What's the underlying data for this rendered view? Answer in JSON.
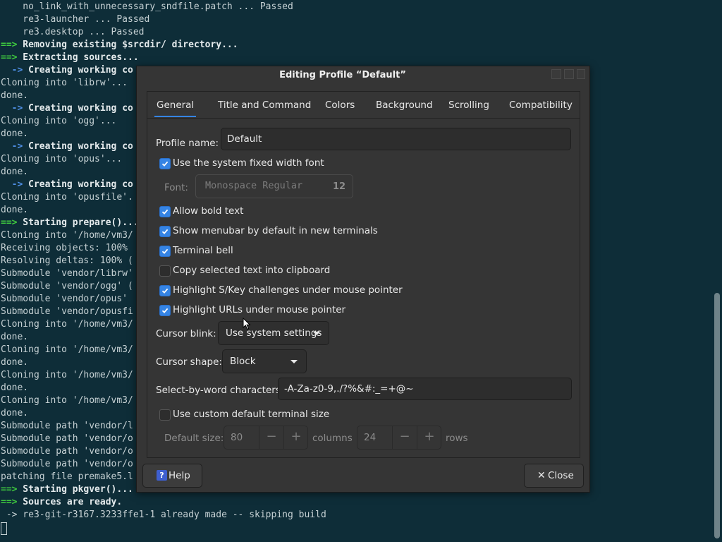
{
  "terminal": {
    "lines": [
      {
        "prefix": "",
        "text": "    no_link_with_unnecessary_sndfile.patch ... Passed",
        "style": "plain"
      },
      {
        "prefix": "",
        "text": "    re3-launcher ... Passed",
        "style": "plain"
      },
      {
        "prefix": "",
        "text": "    re3.desktop ... Passed",
        "style": "plain"
      },
      {
        "prefix": "==>",
        "text": " Removing existing $srcdir/ directory...",
        "style": "green"
      },
      {
        "prefix": "==>",
        "text": " Extracting sources...",
        "style": "green"
      },
      {
        "prefix": "  ->",
        "text": " Creating working co",
        "style": "blue"
      },
      {
        "prefix": "",
        "text": "Cloning into 'librw'...",
        "style": "plain"
      },
      {
        "prefix": "",
        "text": "done.",
        "style": "plain"
      },
      {
        "prefix": "  ->",
        "text": " Creating working co",
        "style": "blue"
      },
      {
        "prefix": "",
        "text": "Cloning into 'ogg'...",
        "style": "plain"
      },
      {
        "prefix": "",
        "text": "done.",
        "style": "plain"
      },
      {
        "prefix": "  ->",
        "text": " Creating working co",
        "style": "blue"
      },
      {
        "prefix": "",
        "text": "Cloning into 'opus'...",
        "style": "plain"
      },
      {
        "prefix": "",
        "text": "done.",
        "style": "plain"
      },
      {
        "prefix": "  ->",
        "text": " Creating working co",
        "style": "blue"
      },
      {
        "prefix": "",
        "text": "Cloning into 'opusfile'.",
        "style": "plain"
      },
      {
        "prefix": "",
        "text": "done.",
        "style": "plain"
      },
      {
        "prefix": "==>",
        "text": " Starting prepare()...",
        "style": "green"
      },
      {
        "prefix": "",
        "text": "Cloning into '/home/vm3/",
        "style": "plain"
      },
      {
        "prefix": "",
        "text": "Receiving objects: 100%",
        "style": "plain"
      },
      {
        "prefix": "",
        "text": "Resolving deltas: 100% (",
        "style": "plain"
      },
      {
        "prefix": "",
        "text": "Submodule 'vendor/librw'",
        "style": "plain"
      },
      {
        "prefix": "",
        "text": "Submodule 'vendor/ogg' (",
        "style": "plain"
      },
      {
        "prefix": "",
        "text": "Submodule 'vendor/opus'",
        "style": "plain"
      },
      {
        "prefix": "",
        "text": "Submodule 'vendor/opusfi",
        "style": "plain"
      },
      {
        "prefix": "",
        "text": "Cloning into '/home/vm3/",
        "style": "plain"
      },
      {
        "prefix": "",
        "text": "done.",
        "style": "plain"
      },
      {
        "prefix": "",
        "text": "Cloning into '/home/vm3/",
        "style": "plain"
      },
      {
        "prefix": "",
        "text": "done.",
        "style": "plain"
      },
      {
        "prefix": "",
        "text": "Cloning into '/home/vm3/",
        "style": "plain"
      },
      {
        "prefix": "",
        "text": "done.",
        "style": "plain"
      },
      {
        "prefix": "",
        "text": "Cloning into '/home/vm3/",
        "style": "plain"
      },
      {
        "prefix": "",
        "text": "done.",
        "style": "plain"
      },
      {
        "prefix": "",
        "text": "Submodule path 'vendor/l",
        "style": "plain"
      },
      {
        "prefix": "",
        "text": "Submodule path 'vendor/o",
        "style": "plain"
      },
      {
        "prefix": "",
        "text": "Submodule path 'vendor/o",
        "style": "plain"
      },
      {
        "prefix": "",
        "text": "Submodule path 'vendor/o",
        "style": "plain"
      },
      {
        "prefix": "",
        "text": "patching file premake5.l",
        "style": "plain"
      },
      {
        "prefix": "==>",
        "text": " Starting pkgver()...",
        "style": "green"
      },
      {
        "prefix": "==>",
        "text": " Sources are ready.",
        "style": "green"
      },
      {
        "prefix": " ->",
        "text": " re3-git-r3167.3233ffe1-1 already made -- skipping build",
        "style": "plainarrow"
      }
    ]
  },
  "dialog": {
    "title": "Editing Profile “Default”",
    "tabs": [
      {
        "label": "General",
        "active": true
      },
      {
        "label": "Title and Command",
        "active": false
      },
      {
        "label": "Colors",
        "active": false
      },
      {
        "label": "Background",
        "active": false
      },
      {
        "label": "Scrolling",
        "active": false
      },
      {
        "label": "Compatibility",
        "active": false
      }
    ],
    "profile_name_label": "Profile name:",
    "profile_name_value": "Default",
    "font_label": "Font:",
    "font_name": "Monospace Regular",
    "font_size": "12",
    "checkboxes": [
      {
        "label": "Use the system fixed width font",
        "checked": true
      },
      {
        "label": "Allow bold text",
        "checked": true
      },
      {
        "label": "Show menubar by default in new terminals",
        "checked": true
      },
      {
        "label": "Terminal bell",
        "checked": true
      },
      {
        "label": "Copy selected text into clipboard",
        "checked": false
      },
      {
        "label": "Highlight S/Key challenges under mouse pointer",
        "checked": true
      },
      {
        "label": "Highlight URLs under mouse pointer",
        "checked": true
      }
    ],
    "cursor_blink_label": "Cursor blink:",
    "cursor_blink_value": "Use system settings",
    "cursor_shape_label": "Cursor shape:",
    "cursor_shape_value": "Block",
    "word_chars_label": "Select-by-word characters:",
    "word_chars_value": "-A-Za-z0-9,./?%&#:_=+@~",
    "custom_size_label": "Use custom default terminal size",
    "custom_size_checked": false,
    "default_size_label": "Default size:",
    "columns_value": "80",
    "columns_label": "columns",
    "rows_value": "24",
    "rows_label": "rows",
    "help_label": "Help",
    "close_label": "Close"
  },
  "colors": {
    "terminal_bg": "#0e2d38",
    "dialog_bg": "#353535",
    "accent": "#3584e4",
    "prompt_green": "#3fc93f",
    "prompt_blue": "#4f8fe6"
  }
}
